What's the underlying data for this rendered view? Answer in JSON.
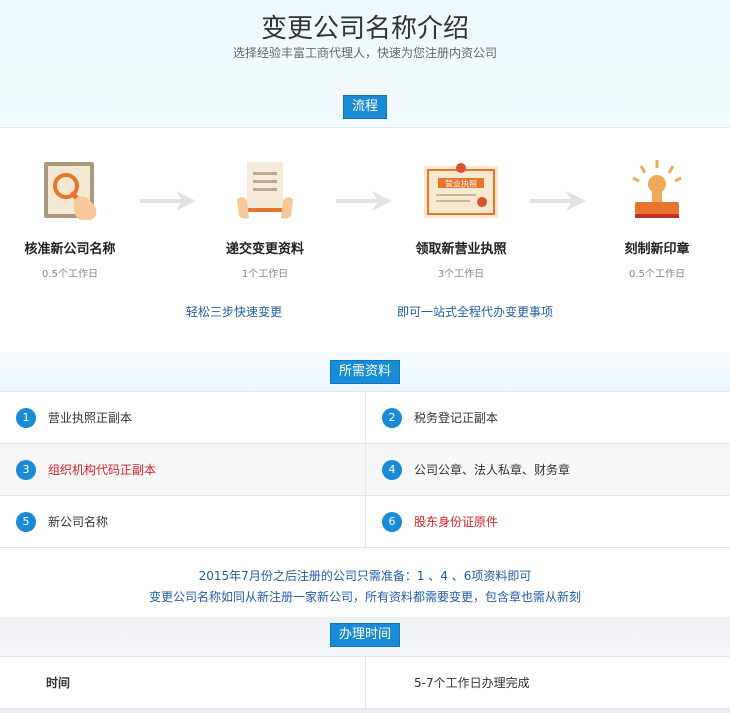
{
  "header": {
    "title": "变更公司名称介绍",
    "subtitle": "选择经验丰富工商代理人，快速为您注册内资公司"
  },
  "process": {
    "label": "流程",
    "steps": [
      {
        "title": "核准新公司名称",
        "days": "0.5个工作日",
        "icon": "magnifier-document-icon"
      },
      {
        "title": "递交变更资料",
        "days": "1个工作日",
        "icon": "hands-document-icon"
      },
      {
        "title": "领取新营业执照",
        "days": "3个工作日",
        "icon": "business-license-icon"
      },
      {
        "title": "刻制新印章",
        "days": "0.5个工作日",
        "icon": "stamp-icon"
      }
    ],
    "license_text": "营业执照",
    "taglines": [
      "轻松三步快速变更",
      "即可一站式全程代办变更事项"
    ]
  },
  "materials": {
    "label": "所需资料",
    "items": [
      {
        "num": "1",
        "text": "营业执照正副本",
        "highlight": false
      },
      {
        "num": "2",
        "text": "税务登记正副本",
        "highlight": false
      },
      {
        "num": "3",
        "text": "组织机构代码正副本",
        "highlight": true
      },
      {
        "num": "4",
        "text": "公司公章、法人私章、财务章",
        "highlight": false
      },
      {
        "num": "5",
        "text": "新公司名称",
        "highlight": false
      },
      {
        "num": "6",
        "text": "股东身份证原件",
        "highlight": true
      }
    ],
    "notes": [
      "2015年7月份之后注册的公司只需准备：1 、4 、6项资料即可",
      "变更公司名称如同从新注册一家新公司，所有资料都需要变更，包含章也需从新刻"
    ]
  },
  "timing": {
    "label": "办理时间",
    "row_label": "时间",
    "row_value": "5-7个工作日办理完成"
  },
  "colors": {
    "accent": "#1a8bd6",
    "highlight": "#d81f26",
    "link": "#1f5fa6"
  }
}
